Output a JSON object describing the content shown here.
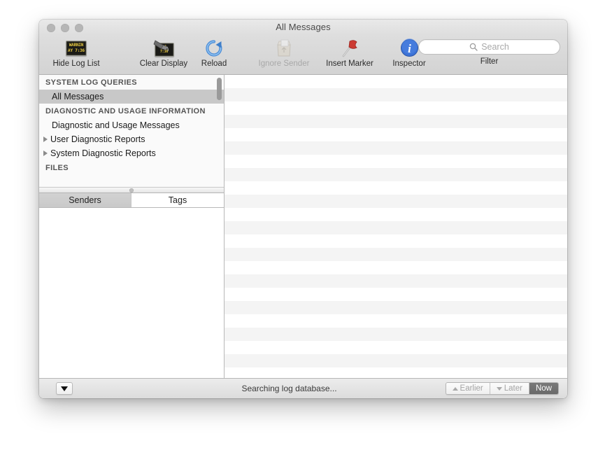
{
  "window": {
    "title": "All Messages",
    "traffic_lights": [
      "close",
      "minimize",
      "zoom"
    ]
  },
  "toolbar": {
    "items": [
      {
        "id": "hide-log-list",
        "label": "Hide Log List",
        "icon": "log-display-icon",
        "enabled": true
      },
      {
        "id": "clear-display",
        "label": "Clear Display",
        "icon": "clear-display-icon",
        "enabled": true
      },
      {
        "id": "reload",
        "label": "Reload",
        "icon": "reload-icon",
        "enabled": true
      },
      {
        "id": "ignore-sender",
        "label": "Ignore Sender",
        "icon": "ignore-sender-icon",
        "enabled": false
      },
      {
        "id": "insert-marker",
        "label": "Insert Marker",
        "icon": "marker-flag-icon",
        "enabled": true
      },
      {
        "id": "inspector",
        "label": "Inspector",
        "icon": "info-icon",
        "enabled": true
      }
    ],
    "led_icon": {
      "line1": "WARNIN",
      "line2": "AY 7:36"
    },
    "search": {
      "placeholder": "Search",
      "value": "",
      "icon": "search-icon",
      "caption": "Filter"
    }
  },
  "sidebar": {
    "groups": [
      {
        "title": "SYSTEM LOG QUERIES",
        "items": [
          {
            "label": "All Messages",
            "selected": true,
            "disclosure": false
          }
        ]
      },
      {
        "title": "DIAGNOSTIC AND USAGE INFORMATION",
        "items": [
          {
            "label": "Diagnostic and Usage Messages",
            "selected": false,
            "disclosure": false
          },
          {
            "label": "User Diagnostic Reports",
            "selected": false,
            "disclosure": true
          },
          {
            "label": "System Diagnostic Reports",
            "selected": false,
            "disclosure": true
          }
        ]
      },
      {
        "title": "FILES",
        "items": []
      }
    ],
    "tabs": [
      {
        "label": "Senders",
        "active": true
      },
      {
        "label": "Tags",
        "active": false
      }
    ],
    "sender_list_items": []
  },
  "message_table": {
    "rows": [],
    "row_count": 23
  },
  "statusbar": {
    "action_menu_icon": "triangle-down-icon",
    "status_text": "Searching log database...",
    "segments": [
      {
        "label": "Earlier",
        "icon": "triangle-up-icon",
        "active": false,
        "enabled": false
      },
      {
        "label": "Later",
        "icon": "triangle-down-icon",
        "active": false,
        "enabled": false
      },
      {
        "label": "Now",
        "icon": "",
        "active": true,
        "enabled": true
      }
    ]
  },
  "colors": {
    "window_chrome": "#dedede",
    "selection_grey": "#c8c8c8",
    "alt_row": "#f4f4f4",
    "segment_active": "#6f6f6f",
    "inspector_blue": "#3c72d6",
    "marker_red": "#cc3b33",
    "led_amber": "#e8c940"
  }
}
